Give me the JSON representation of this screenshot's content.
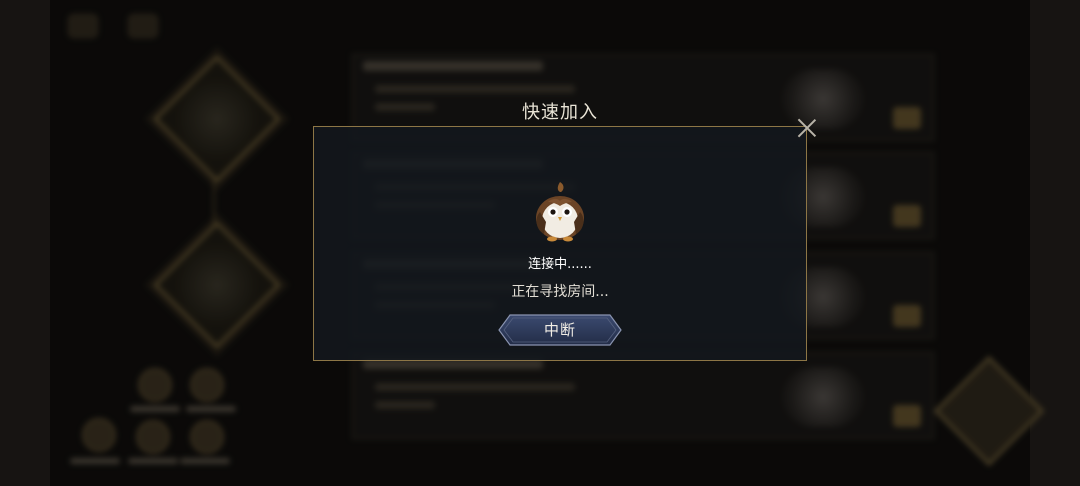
{
  "dialog": {
    "title": "快速加入",
    "status": "连接中......",
    "subtitle": "正在寻找房间...",
    "stop_label": "中断",
    "mascot_icon": "owl-mascot-icon",
    "close_icon": "close-icon"
  },
  "colors": {
    "accent_gold": "#8d7646",
    "button_blue": "#2c3a5c",
    "dialog_bg": "#14181e"
  }
}
